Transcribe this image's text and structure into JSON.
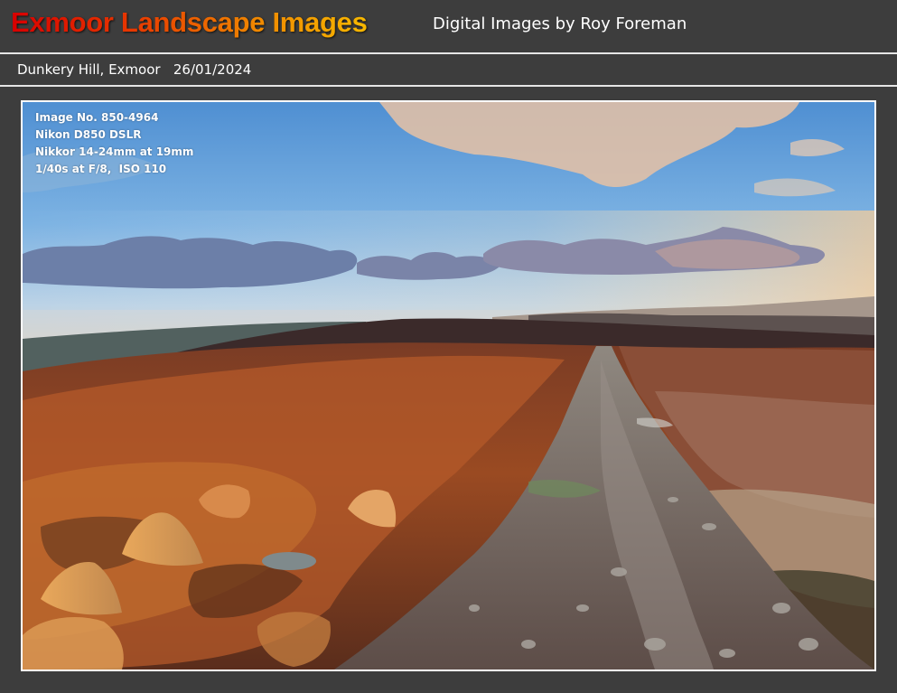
{
  "header": {
    "title": "Exmoor Landscape Images",
    "subtitle": "Digital Images by Roy Foreman"
  },
  "caption": {
    "location": "Dunkery Hill, Exmoor",
    "date": "26/01/2024"
  },
  "photo": {
    "exif": {
      "image_no": "Image No. 850-4964",
      "camera": "Nikon D850 DSLR",
      "lens": "Nikkor 14-24mm at 19mm",
      "settings": "1/40s at F/8,  ISO 110"
    }
  },
  "colors": {
    "background": "#3d3d3d",
    "rule": "#e6e6e6",
    "title_gradient_start": "#d80000",
    "title_gradient_end": "#f7b800"
  }
}
